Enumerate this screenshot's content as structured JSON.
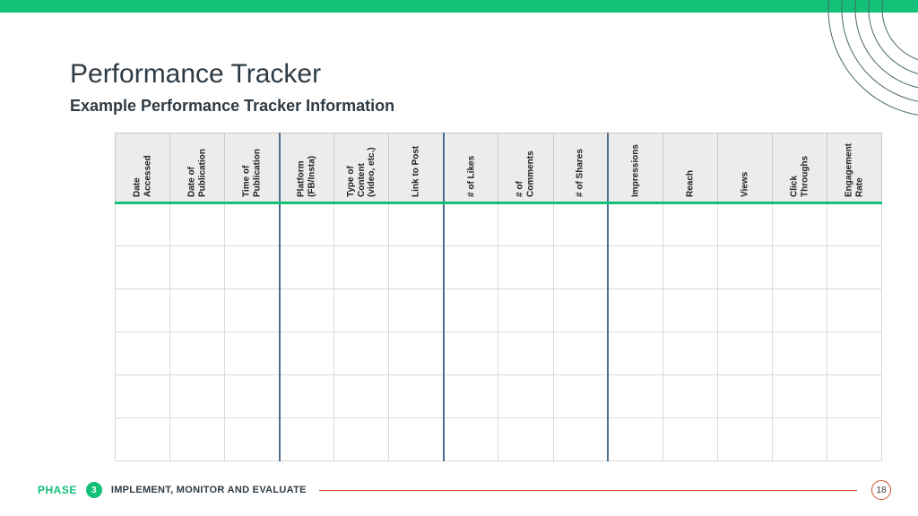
{
  "header": {
    "title": "Performance Tracker",
    "subtitle": "Example Performance Tracker Information"
  },
  "table": {
    "columns": [
      {
        "label": "Date\nAccessed",
        "sep": false
      },
      {
        "label": "Date of\nPublication",
        "sep": false
      },
      {
        "label": "Time of\nPublication",
        "sep": true
      },
      {
        "label": "Platform\n(FB/Insta)",
        "sep": false
      },
      {
        "label": "Type of\nContent\n(video, etc.)",
        "sep": false
      },
      {
        "label": "Link to Post",
        "sep": true
      },
      {
        "label": "# of Likes",
        "sep": false
      },
      {
        "label": "# of\nComments",
        "sep": false
      },
      {
        "label": "# of Shares",
        "sep": true
      },
      {
        "label": "Impressions",
        "sep": false
      },
      {
        "label": "Reach",
        "sep": false
      },
      {
        "label": "Views",
        "sep": false
      },
      {
        "label": "Click\nThroughs",
        "sep": false
      },
      {
        "label": "Engagement\nRate",
        "sep": false
      }
    ],
    "num_empty_rows": 6
  },
  "footer": {
    "phase_label": "PHASE",
    "phase_number": "3",
    "phase_name": "IMPLEMENT, MONITOR AND EVALUATE",
    "page_number": "18"
  },
  "colors": {
    "accent_green": "#13c078",
    "separator_blue": "#4f6e8c",
    "footer_line": "#d1502f"
  }
}
